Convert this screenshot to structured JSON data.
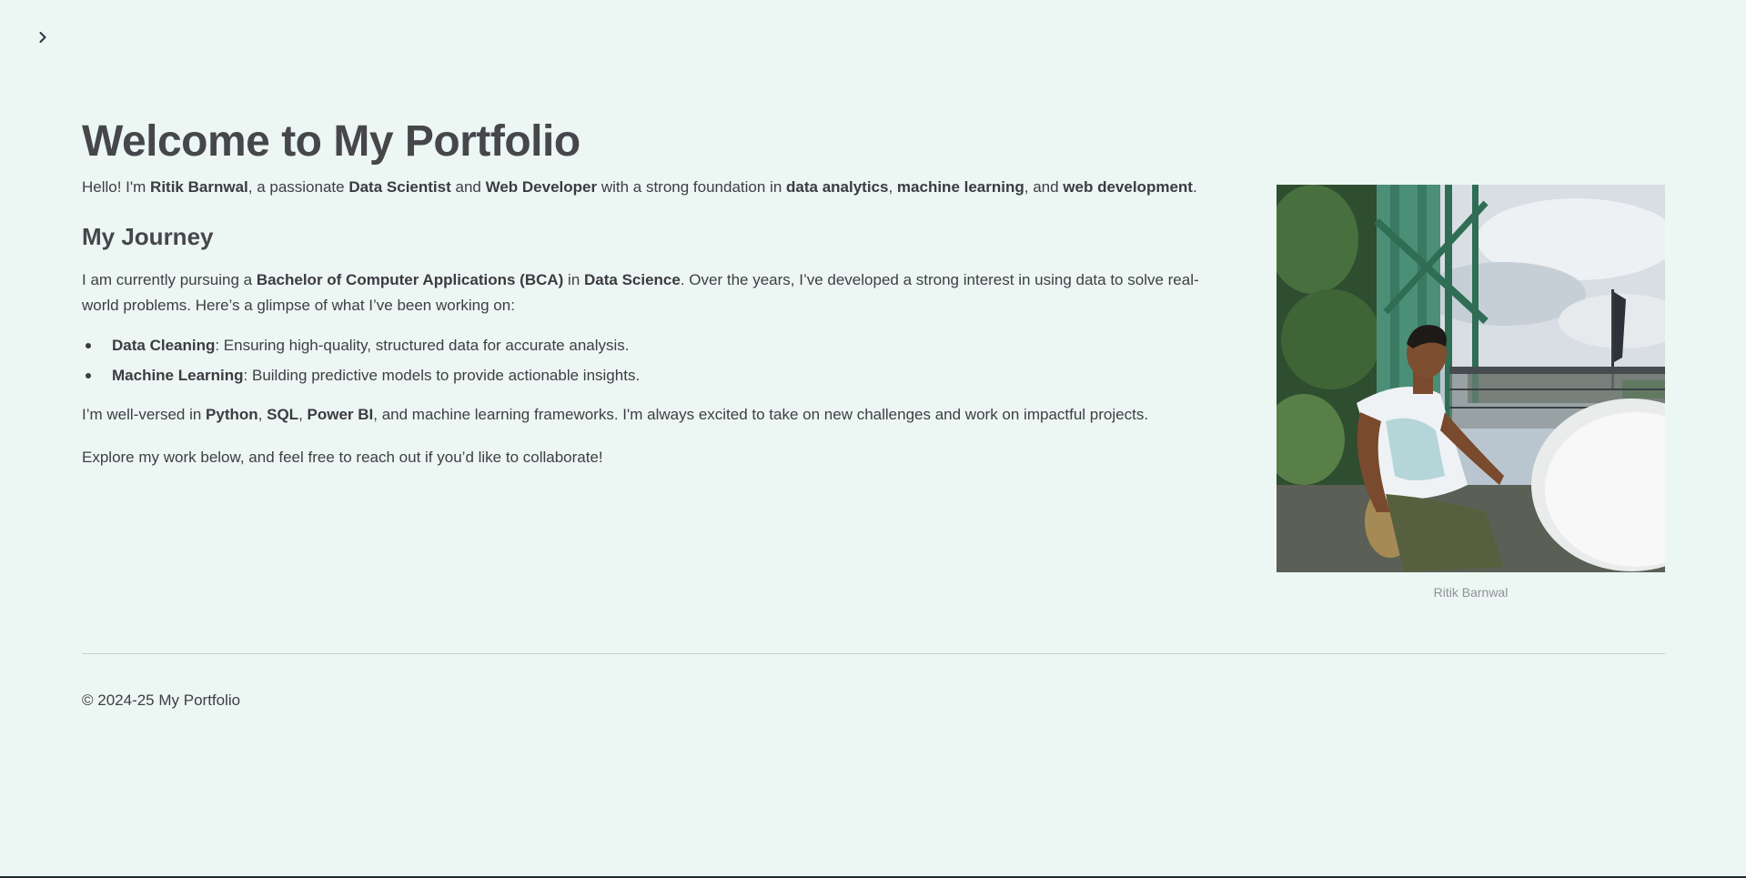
{
  "header": {
    "sidebar_toggle_icon": "chevron-right-icon"
  },
  "main": {
    "title": "Welcome to My Portfolio",
    "intro": {
      "t1": "Hello! I'm ",
      "name": "Ritik Barnwal",
      "t2": ", a passionate ",
      "role1": "Data Scientist",
      "t3": " and ",
      "role2": "Web Developer",
      "t4": " with a strong foundation in ",
      "skill1": "data analytics",
      "t5": ", ",
      "skill2": "machine learning",
      "t6": ", and ",
      "skill3": "web development",
      "t7": "."
    },
    "journey": {
      "heading": "My Journey",
      "p1": "I am currently pursuing a ",
      "degree": "Bachelor of Computer Applications (BCA)",
      "p2": " in ",
      "field": "Data Science",
      "p3": ". Over the years, I’ve developed a strong interest in using data to solve real-world problems. Here’s a glimpse of what I’ve been working on:"
    },
    "skills": [
      {
        "label": "Data Cleaning",
        "desc": ": Ensuring high-quality, structured data for accurate analysis."
      },
      {
        "label": "Machine Learning",
        "desc": ": Building predictive models to provide actionable insights."
      }
    ],
    "tools": {
      "t1": "I’m well-versed in ",
      "tool1": "Python",
      "sep1": ", ",
      "tool2": "SQL",
      "sep2": ", ",
      "tool3": "Power BI",
      "t2": ", and machine learning frameworks. I'm always excited to take on new challenges and work on impactful projects."
    },
    "explore": "Explore my work below, and feel free to reach out if you’d like to collaborate!"
  },
  "profile_image": {
    "caption": "Ritik Barnwal"
  },
  "footer": {
    "text": "© 2024-25 My Portfolio"
  }
}
